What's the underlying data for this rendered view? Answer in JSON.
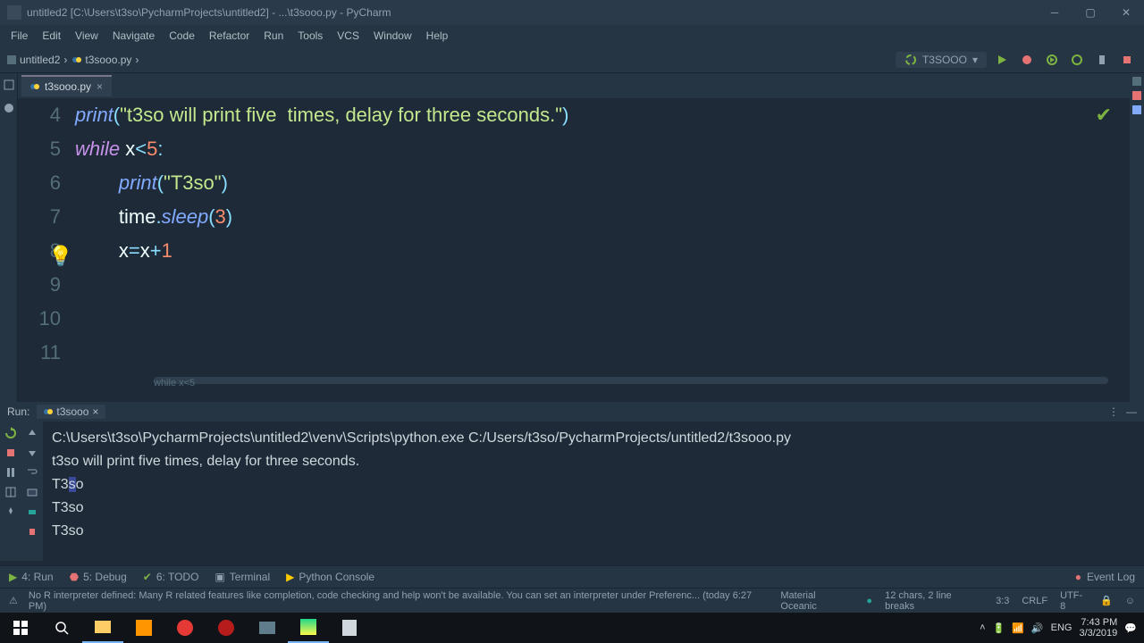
{
  "window": {
    "title": "untitled2 [C:\\Users\\t3so\\PycharmProjects\\untitled2] - ...\\t3sooo.py - PyCharm"
  },
  "menu": [
    "File",
    "Edit",
    "View",
    "Navigate",
    "Code",
    "Refactor",
    "Run",
    "Tools",
    "VCS",
    "Window",
    "Help"
  ],
  "breadcrumb": {
    "project": "untitled2",
    "file": "t3sooo.py"
  },
  "run_config": "T3SOOO",
  "tab": {
    "name": "t3sooo.py"
  },
  "editor": {
    "lines": [
      4,
      5,
      6,
      7,
      8,
      9,
      10,
      11
    ],
    "code": {
      "l4_print": "print",
      "l4_str": "\"t3so will print five  times, delay for three seconds.\"",
      "l5_while": "while",
      "l5_cond": "x",
      "l5_op": "<",
      "l5_num": "5",
      "l6_print": "print",
      "l6_str": "\"T3so\"",
      "l7_time": "time",
      "l7_sleep": "sleep",
      "l7_num": "3",
      "l8_x": "x",
      "l8_eq": "=",
      "l8_x2": "x",
      "l8_plus": "+",
      "l8_one": "1"
    },
    "breadcrumb": "while x<5"
  },
  "run_panel": {
    "label": "Run:",
    "tab": "t3sooo",
    "lines": [
      "C:\\Users\\t3so\\PycharmProjects\\untitled2\\venv\\Scripts\\python.exe C:/Users/t3so/PycharmProjects/untitled2/t3sooo.py",
      "t3so will print five  times, delay for three seconds.",
      "T3so",
      "T3so",
      "T3so"
    ]
  },
  "tool_tabs": {
    "run": "4: Run",
    "debug": "5: Debug",
    "todo": "6: TODO",
    "terminal": "Terminal",
    "python": "Python Console",
    "eventlog": "Event Log"
  },
  "status": {
    "warning": "No R interpreter defined: Many R related features like completion, code checking and help won't be available. You can set an interpreter under Preferenc... (today 6:27 PM)",
    "theme": "Material Oceanic",
    "sel": "12 chars, 2 line breaks",
    "pos": "3:3",
    "crlf": "CRLF",
    "enc": "UTF-8",
    "lock": "🔒"
  },
  "taskbar": {
    "lang": "ENG",
    "time": "7:43 PM",
    "date": "3/3/2019"
  }
}
